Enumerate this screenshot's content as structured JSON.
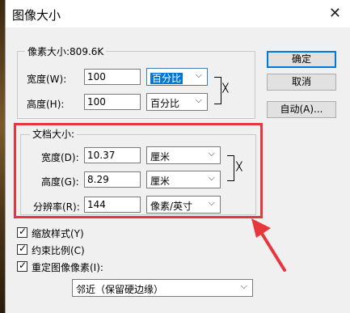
{
  "window": {
    "title": "图像大小",
    "close_glyph": "✕"
  },
  "pixel_dimensions": {
    "legend": "像素大小:809.6K",
    "width": {
      "label": "宽度(W):",
      "value": "100",
      "unit": "百分比"
    },
    "height": {
      "label": "高度(H):",
      "value": "100",
      "unit": "百分比"
    },
    "link_icon": "chain-link-icon"
  },
  "document_size": {
    "legend": "文档大小:",
    "width": {
      "label": "宽度(D):",
      "value": "10.37",
      "unit": "厘米"
    },
    "height": {
      "label": "高度(G):",
      "value": "8.29",
      "unit": "厘米"
    },
    "resolution": {
      "label": "分辨率(R):",
      "value": "144",
      "unit": "像素/英寸"
    }
  },
  "buttons": {
    "ok": "确定",
    "cancel": "取消",
    "auto": "自动(A)..."
  },
  "options": {
    "scale_styles": "缩放样式(Y)",
    "constrain": "约束比例(C)",
    "resample": "重定图像像素(I):",
    "resample_method": "邻近（保留硬边缘）"
  },
  "colors": {
    "highlight_box": "#e8373c",
    "selection": "#0078d7"
  }
}
